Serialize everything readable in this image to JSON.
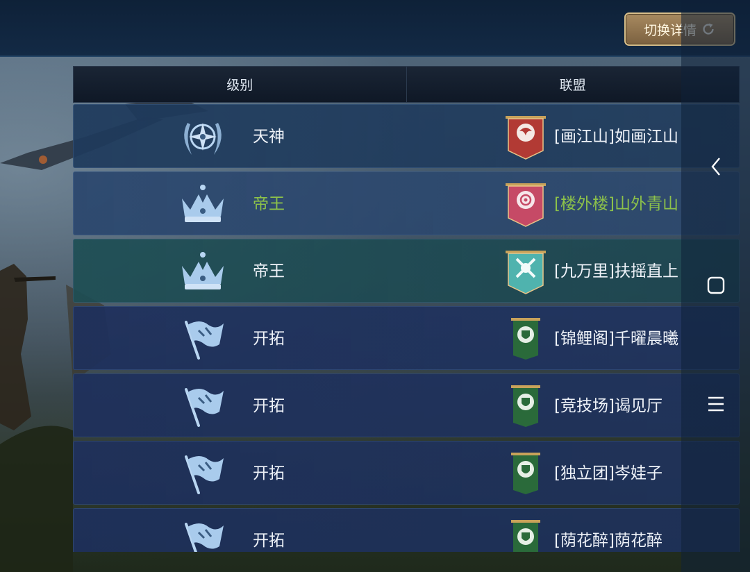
{
  "header": {
    "switch_label": "切换详情",
    "switch_icon": "refresh-icon"
  },
  "table": {
    "columns": [
      "级别",
      "联盟"
    ],
    "rows": [
      {
        "rank": "天神",
        "rank_icon": "laurel-compass-emblem-icon",
        "alliance": "[画江山]如画江山",
        "banner": "red-dragon-banner-icon",
        "highlight": false
      },
      {
        "rank": "帝王",
        "rank_icon": "crown-icon",
        "alliance": "[楼外楼]山外青山",
        "banner": "pink-rose-banner-icon",
        "highlight": true
      },
      {
        "rank": "帝王",
        "rank_icon": "crown-icon",
        "alliance": "[九万里]扶摇直上",
        "banner": "teal-axes-banner-icon",
        "highlight": false
      },
      {
        "rank": "开拓",
        "rank_icon": "flag-icon",
        "alliance": "[锦鲤阁]千曜晨曦",
        "banner": "green-shield-banner-icon",
        "highlight": false
      },
      {
        "rank": "开拓",
        "rank_icon": "flag-icon",
        "alliance": "[竞技场]谒见厅",
        "banner": "green-shield-banner-icon",
        "highlight": false
      },
      {
        "rank": "开拓",
        "rank_icon": "flag-icon",
        "alliance": "[独立团]岑娃子",
        "banner": "green-shield-banner-icon",
        "highlight": false
      },
      {
        "rank": "开拓",
        "rank_icon": "flag-icon",
        "alliance": "[荫花醉]荫花醉",
        "banner": "green-shield-banner-icon",
        "highlight": false
      }
    ]
  },
  "system_nav": {
    "back_icon": "back-chevron-icon",
    "home_icon": "home-square-icon",
    "menu_icon": "menu-icon"
  },
  "colors": {
    "highlight_text": "#8dc24a",
    "accent_gold": "#d8bf8a"
  }
}
